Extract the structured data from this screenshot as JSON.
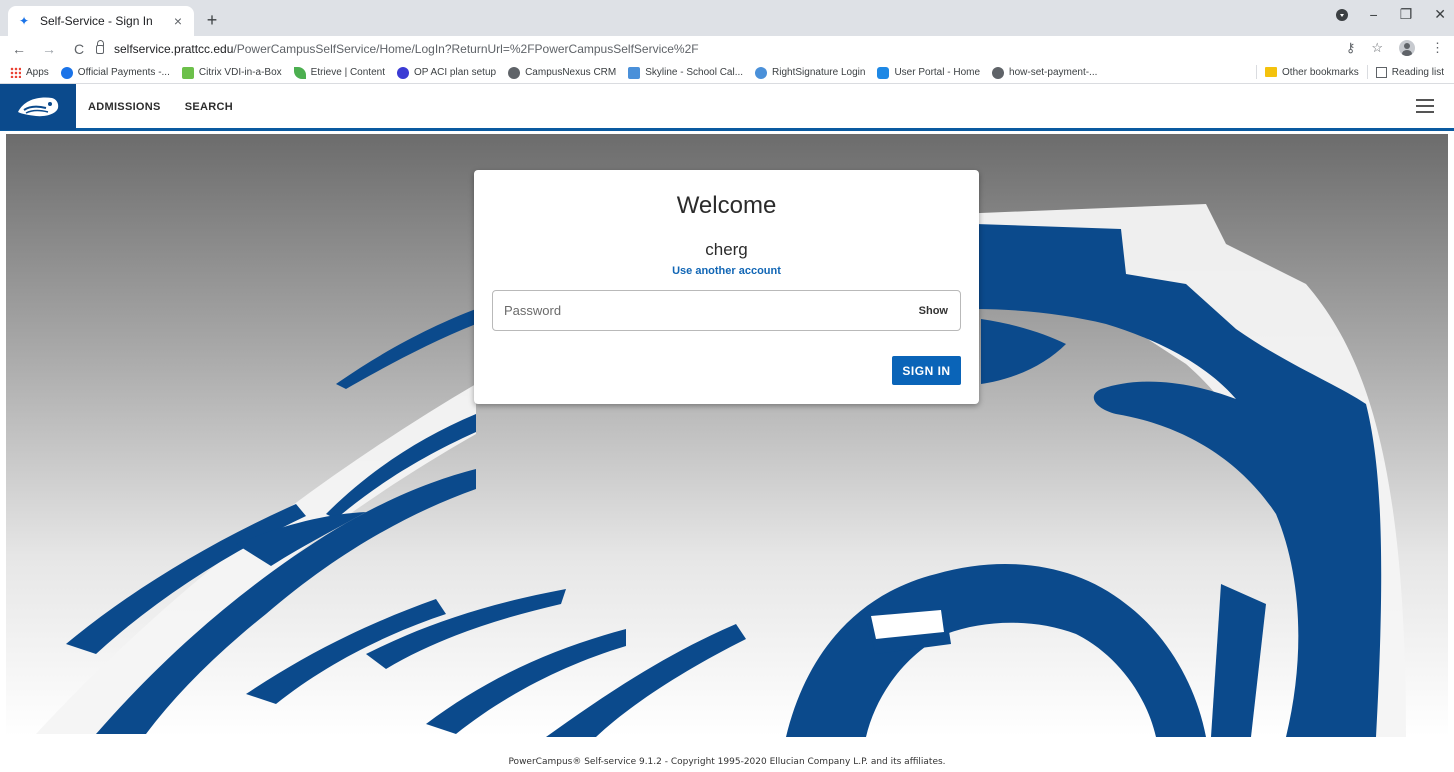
{
  "browser": {
    "tab_title": "Self-Service - Sign In",
    "tab_close": "×",
    "new_tab": "+",
    "url_host": "selfservice.prattcc.edu",
    "url_path": "/PowerCampusSelfService/Home/LogIn?ReturnUrl=%2FPowerCampusSelfService%2F",
    "window_controls": {
      "minimize": "−",
      "maximize": "❐",
      "close": "✕"
    },
    "nav": {
      "back": "←",
      "forward": "→",
      "reload": "C"
    },
    "toolbar_icons": {
      "key": "⚷",
      "star": "☆",
      "menu": "⋮"
    }
  },
  "bookmarks": {
    "items": [
      {
        "label": "Apps",
        "icon": "apps-grid-icon"
      },
      {
        "label": "Official Payments -...",
        "icon": "official-payments-icon",
        "color": "#1a73e8"
      },
      {
        "label": "Citrix VDI-in-a-Box",
        "icon": "citrix-icon",
        "color": "#6cc04a"
      },
      {
        "label": "Etrieve | Content",
        "icon": "etrieve-icon",
        "color": "#4caf50"
      },
      {
        "label": "OP ACI plan setup",
        "icon": "op-aci-icon",
        "color": "#3b3bd4"
      },
      {
        "label": "CampusNexus CRM",
        "icon": "globe-icon",
        "color": "#5f6368"
      },
      {
        "label": "Skyline - School Cal...",
        "icon": "skyline-icon",
        "color": "#4a90d9"
      },
      {
        "label": "RightSignature Login",
        "icon": "rightsignature-icon",
        "color": "#4a90d9"
      },
      {
        "label": "User Portal - Home",
        "icon": "user-portal-icon",
        "color": "#1e88e5"
      },
      {
        "label": "how-set-payment-...",
        "icon": "globe-icon",
        "color": "#5f6368"
      }
    ],
    "other": "Other bookmarks",
    "reading_list": "Reading list"
  },
  "appbar": {
    "links": [
      "ADMISSIONS",
      "SEARCH"
    ],
    "brand_color": "#0b4a8c"
  },
  "login": {
    "title": "Welcome",
    "username": "cherg",
    "another_account": "Use another account",
    "password_placeholder": "Password",
    "show_label": "Show",
    "signin_label": "SIGN IN"
  },
  "footer": "PowerCampus® Self-service 9.1.2 - Copyright 1995-2020 Ellucian Company L.P. and its affiliates."
}
